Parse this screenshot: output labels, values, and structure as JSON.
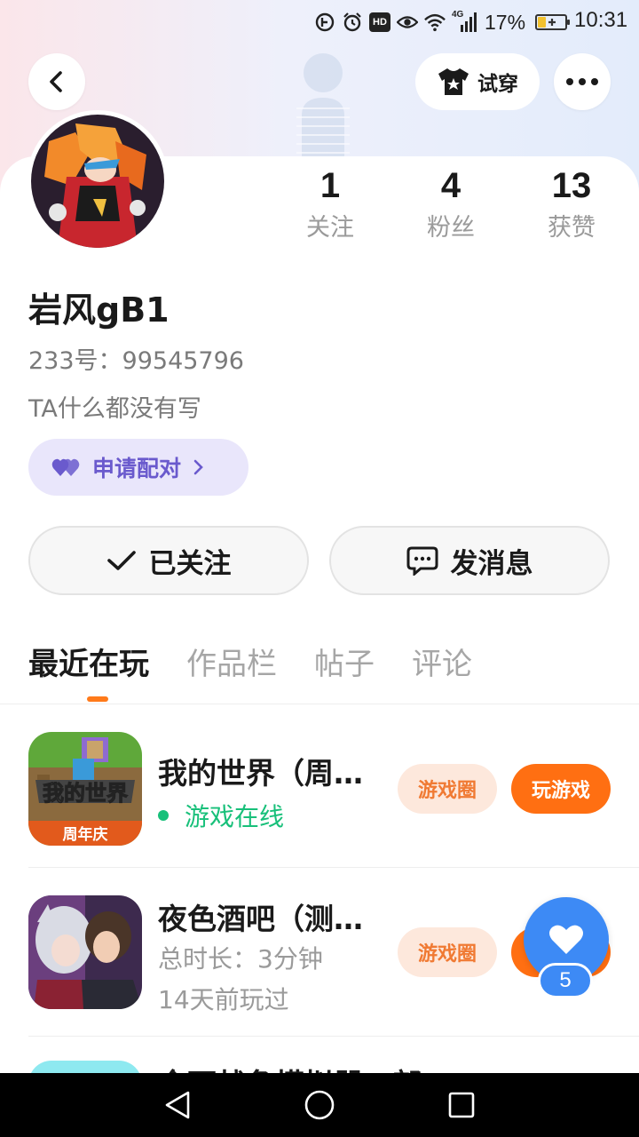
{
  "status_bar": {
    "battery": "17%",
    "time": "10:31",
    "network": "4G",
    "battery_level": 0.17,
    "icons": [
      "nfc-icon",
      "alarm-icon",
      "hd-icon",
      "eye-comfort-icon",
      "wifi-icon",
      "signal-icon",
      "battery-icon"
    ]
  },
  "header": {
    "try_on_label": "试穿"
  },
  "profile": {
    "stats": [
      {
        "value": "1",
        "label": "关注"
      },
      {
        "value": "4",
        "label": "粉丝"
      },
      {
        "value": "13",
        "label": "获赞"
      }
    ],
    "username": "岩风gB1",
    "user_id": "233号：99545796",
    "bio": "TA什么都没有写",
    "pair_button": "申请配对",
    "follow_button": "已关注",
    "message_button": "发消息"
  },
  "tabs": [
    {
      "label": "最近在玩",
      "active": true
    },
    {
      "label": "作品栏",
      "active": false
    },
    {
      "label": "帖子",
      "active": false
    },
    {
      "label": "评论",
      "active": false
    }
  ],
  "games": [
    {
      "title": "我的世界（周…",
      "status": "游戏在线",
      "circle_label": "游戏圈",
      "play_label": "玩游戏",
      "icon_banner": "周年庆"
    },
    {
      "title": "夜色酒吧（测…",
      "duration": "总时长：3分钟",
      "last_played": "14天前玩过",
      "circle_label": "游戏圈",
      "play_label": "玩游戏"
    },
    {
      "title": "全面战争模拟器：部…"
    }
  ],
  "like_fab": {
    "count": "5"
  },
  "colors": {
    "accent_orange": "#ff6f12",
    "online_green": "#18c07a",
    "pair_purple": "#6a5acd",
    "like_blue": "#3d8af5"
  }
}
